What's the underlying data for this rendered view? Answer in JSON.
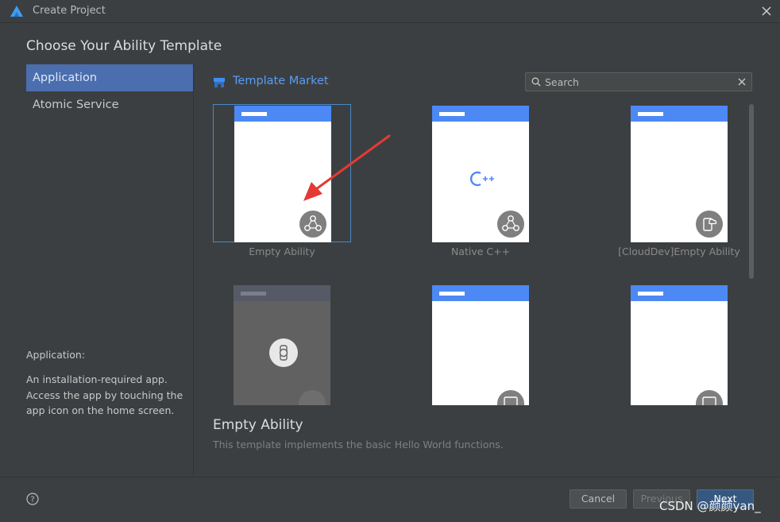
{
  "window": {
    "title": "Create Project"
  },
  "heading": "Choose Your Ability Template",
  "sidebar": {
    "items": [
      {
        "label": "Application",
        "selected": true
      },
      {
        "label": "Atomic Service",
        "selected": false
      }
    ],
    "description_title": "Application:",
    "description": "An installation-required app. Access the app by touching the app icon on the home screen."
  },
  "market": {
    "title": "Template Market"
  },
  "search": {
    "placeholder": "Search"
  },
  "templates": [
    {
      "label": "Empty Ability",
      "icon": "ability-icon",
      "selected": true
    },
    {
      "label": "Native C++",
      "icon": "cpp-icon",
      "selected": false
    },
    {
      "label": "[CloudDev]Empty Ability",
      "icon": "cloud-dev-icon",
      "selected": false
    },
    {
      "label": "",
      "icon": "watch-icon",
      "selected": false
    },
    {
      "label": "",
      "icon": "phone-tablet-icon",
      "selected": false
    },
    {
      "label": "",
      "icon": "phone-tablet-icon",
      "selected": false
    }
  ],
  "detail": {
    "title": "Empty Ability",
    "description": "This template implements the basic Hello World functions."
  },
  "buttons": {
    "cancel": "Cancel",
    "previous": "Previous",
    "next": "Next"
  },
  "watermark": "CSDN @颜颜yan_",
  "colors": {
    "accent": "#4b6eaf",
    "link": "#589df6",
    "card_header": "#4c89f5",
    "arrow": "#e53935"
  }
}
